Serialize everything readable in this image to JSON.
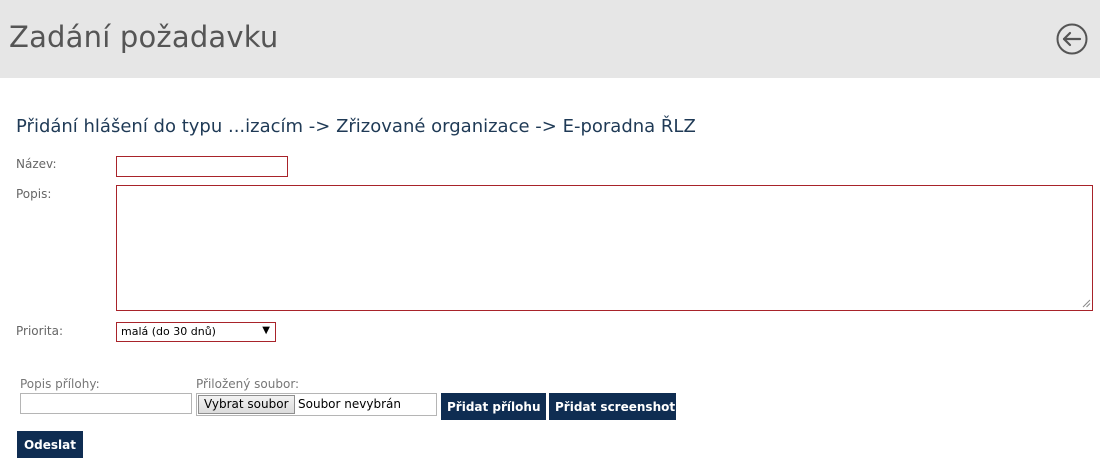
{
  "header": {
    "title": "Zadání požadavku",
    "back_icon": "circle-arrow-left-icon"
  },
  "form": {
    "heading": "Přidání hlášení do typu ...izacím -> Zřizované organizace -> E-poradna ŘLZ",
    "name_label": "Název:",
    "name_value": "",
    "description_label": "Popis:",
    "description_value": "",
    "priority_label": "Priorita:",
    "priority_value": "malá (do 30 dnů)"
  },
  "attachment": {
    "description_label": "Popis přílohy:",
    "description_value": "",
    "file_label": "Přiložený soubor:",
    "file_button_label": "Vybrat soubor",
    "file_status": "Soubor nevybrán",
    "add_attachment_label": "Přidat přílohu",
    "add_screenshot_label": "Přidat screenshot"
  },
  "submit_label": "Odeslat",
  "colors": {
    "header_bg": "#e6e6e6",
    "required_border": "#a8232a",
    "button_bg": "#0f2d52"
  }
}
